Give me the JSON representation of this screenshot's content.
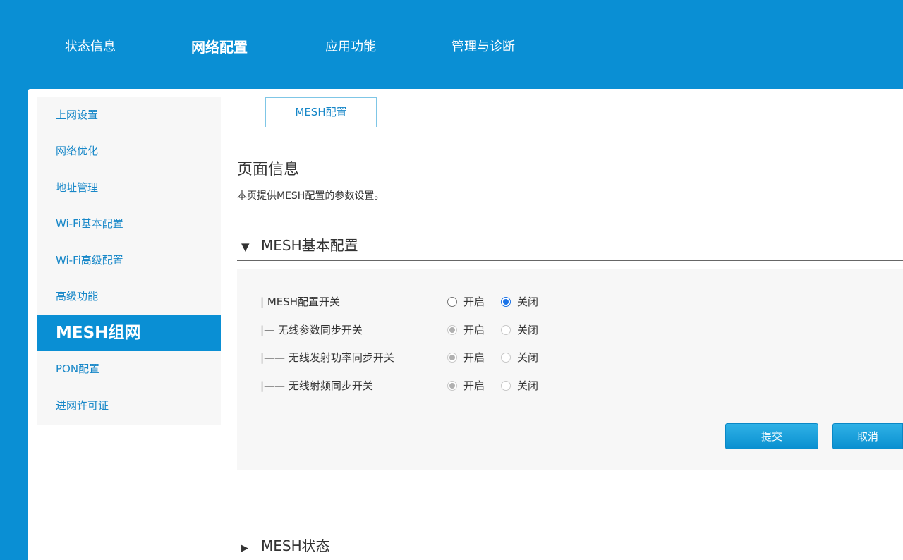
{
  "topnav": {
    "items": [
      {
        "label": "状态信息"
      },
      {
        "label": "网络配置"
      },
      {
        "label": "应用功能"
      },
      {
        "label": "管理与诊断"
      }
    ]
  },
  "sidebar": {
    "items": [
      {
        "label": "上网设置"
      },
      {
        "label": "网络优化"
      },
      {
        "label": "地址管理"
      },
      {
        "label": "Wi-Fi基本配置"
      },
      {
        "label": "Wi-Fi高级配置"
      },
      {
        "label": "高级功能"
      },
      {
        "label": "MESH组网"
      },
      {
        "label": "PON配置"
      },
      {
        "label": "进网许可证"
      }
    ]
  },
  "tabs": [
    {
      "label": "MESH配置"
    }
  ],
  "page": {
    "title": "页面信息",
    "description": "本页提供MESH配置的参数设置。"
  },
  "section_basic": {
    "icon": "triangle-down-icon",
    "title": "MESH基本配置",
    "rows": [
      {
        "label": "| MESH配置开关",
        "on_label": "开启",
        "off_label": "关闭"
      },
      {
        "label": "|— 无线参数同步开关",
        "on_label": "开启",
        "off_label": "关闭"
      },
      {
        "label": "|—— 无线发射功率同步开关",
        "on_label": "开启",
        "off_label": "关闭"
      },
      {
        "label": "|—— 无线射频同步开关",
        "on_label": "开启",
        "off_label": "关闭"
      }
    ],
    "submit_label": "提交",
    "cancel_label": "取消"
  },
  "section_status": {
    "icon": "triangle-right-icon",
    "title": "MESH状态"
  },
  "colors": {
    "brand": "#0a8fd4",
    "link": "#1787c8"
  }
}
